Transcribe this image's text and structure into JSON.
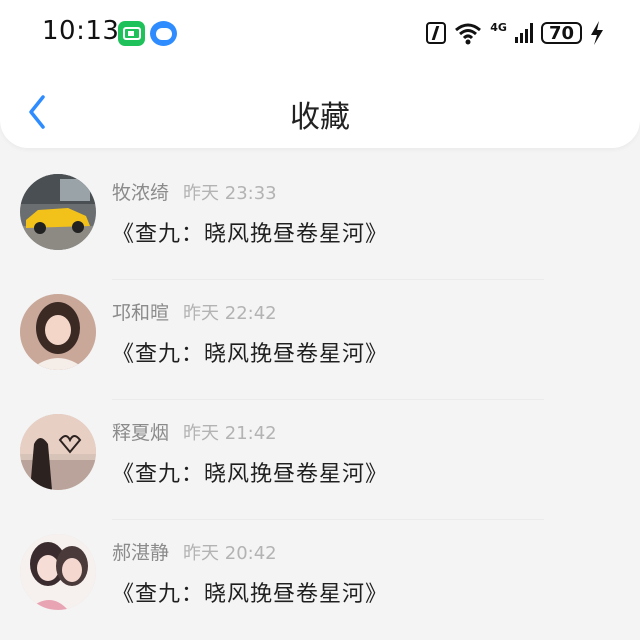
{
  "status_bar": {
    "time": "10:13",
    "network_label": "4G",
    "battery_level": "70"
  },
  "header": {
    "title": "收藏"
  },
  "favorites": [
    {
      "name": "牧浓绮",
      "time": "昨天 23:33",
      "content": "《查九：晓风挽昼卷星河》",
      "avatar": "car-photo"
    },
    {
      "name": "邛和暄",
      "time": "昨天 22:42",
      "content": "《查九：晓风挽昼卷星河》",
      "avatar": "girl-photo"
    },
    {
      "name": "释夏烟",
      "time": "昨天 21:42",
      "content": "《查九：晓风挽昼卷星河》",
      "avatar": "sunset-heart-photo"
    },
    {
      "name": "郝湛静",
      "time": "昨天 20:42",
      "content": "《查九：晓风挽昼卷星河》",
      "avatar": "anime-couple"
    }
  ],
  "colors": {
    "accent": "#2f8cff",
    "name_text": "#8b8b8b",
    "time_text": "#b3b3b3"
  }
}
